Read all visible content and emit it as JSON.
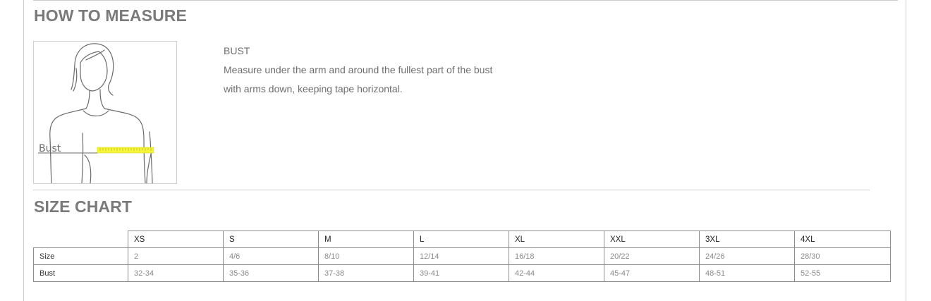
{
  "how_to_measure": {
    "heading": "HOW TO MEASURE",
    "figure_label": "Bust",
    "measure_title": "BUST",
    "measure_lines": [
      "Measure under the arm and around the fullest part of the bust",
      "with arms down, keeping tape horizontal."
    ],
    "tape_color": "#f5f53a"
  },
  "size_chart": {
    "heading": "SIZE CHART",
    "columns": [
      "XS",
      "S",
      "M",
      "L",
      "XL",
      "XXL",
      "3XL",
      "4XL"
    ],
    "rows": [
      {
        "label": "Size",
        "values": [
          "2",
          "4/6",
          "8/10",
          "12/14",
          "16/18",
          "20/22",
          "24/26",
          "28/30"
        ]
      },
      {
        "label": "Bust",
        "values": [
          "32-34",
          "35-36",
          "37-38",
          "39-41",
          "42-44",
          "45-47",
          "48-51",
          "52-55"
        ]
      }
    ]
  }
}
